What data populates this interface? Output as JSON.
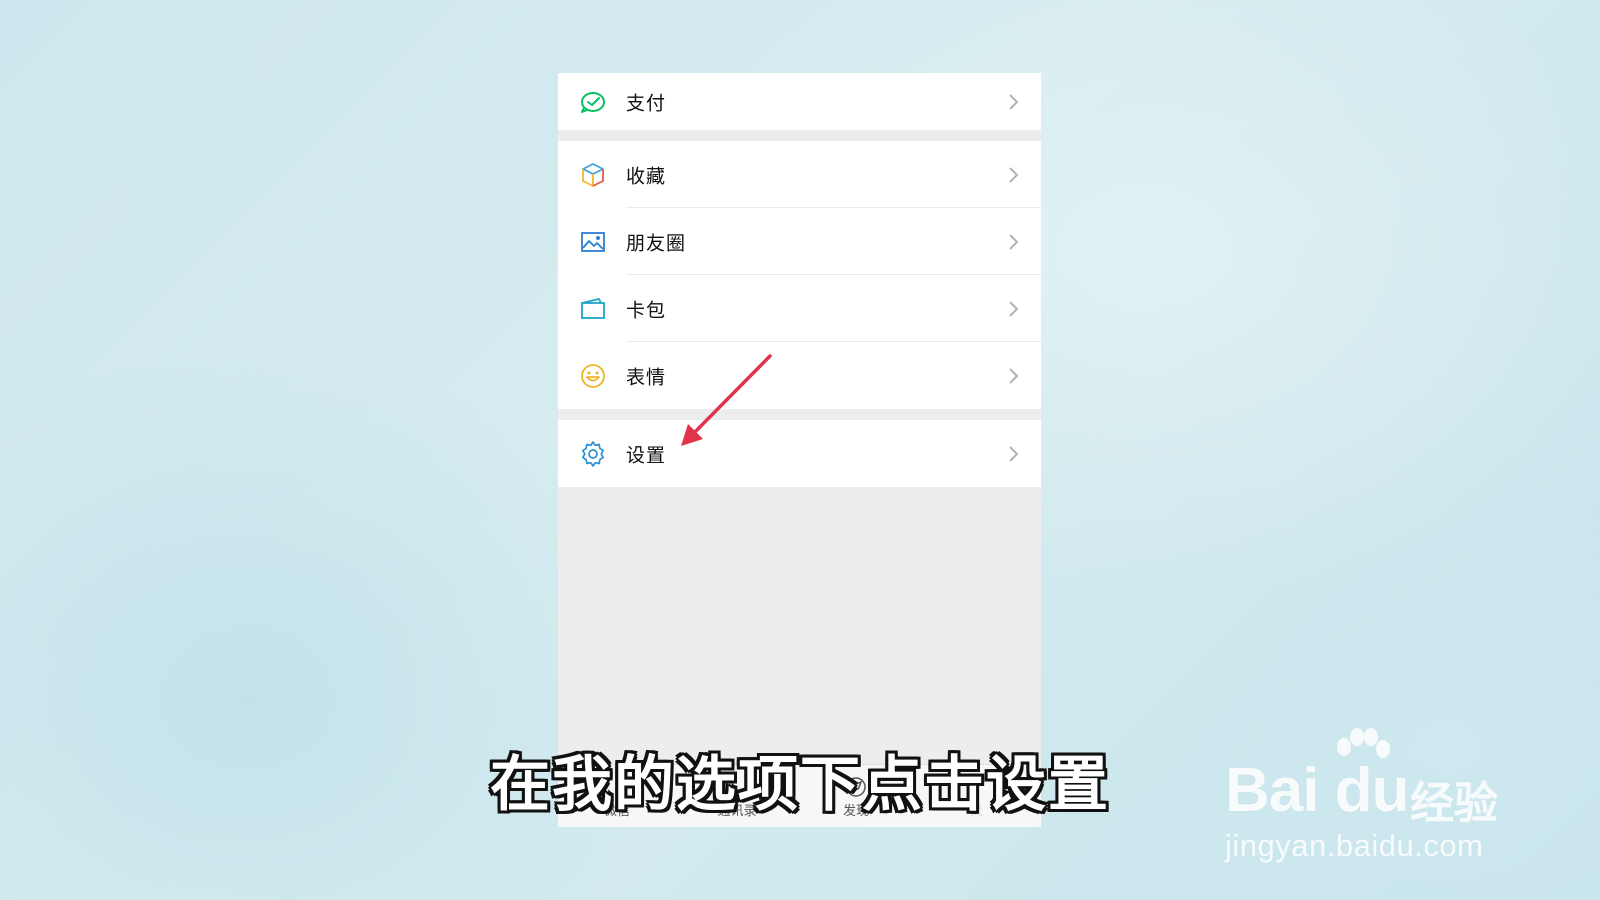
{
  "menu": {
    "groups": [
      [
        {
          "label": "支付",
          "icon": "wallet-check-icon"
        }
      ],
      [
        {
          "label": "收藏",
          "icon": "cube-favorites-icon"
        },
        {
          "label": "朋友圈",
          "icon": "picture-moments-icon"
        },
        {
          "label": "卡包",
          "icon": "card-wallet-icon"
        },
        {
          "label": "表情",
          "icon": "smiley-icon"
        }
      ],
      [
        {
          "label": "设置",
          "icon": "gear-icon"
        }
      ]
    ]
  },
  "tabbar": {
    "tabs": [
      "微信",
      "通讯录",
      "发现",
      "我"
    ]
  },
  "subtitle": "在我的选项下点击设置",
  "watermark": {
    "logo_text": "Bai du",
    "brand_cn": "经验",
    "url": "jingyan.baidu.com"
  },
  "colors": {
    "green": "#07c160",
    "arrow": "#e0344a",
    "gear": "#2a8fd6"
  }
}
